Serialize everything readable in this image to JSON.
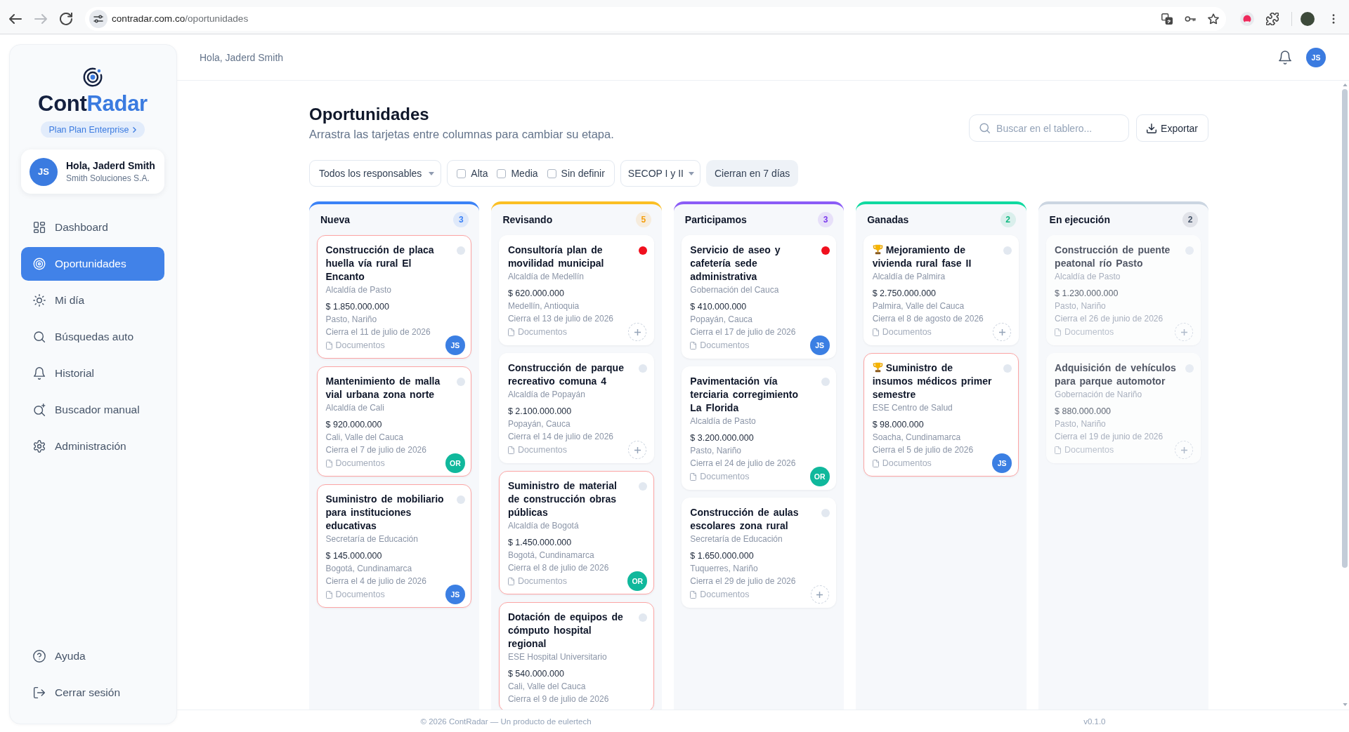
{
  "browser": {
    "nav_buttons": [
      {
        "kind": "back",
        "disabled": false
      },
      {
        "kind": "forward",
        "disabled": true
      },
      {
        "kind": "reload",
        "disabled": false
      }
    ],
    "address_bar": {
      "host": "contradar.com.co",
      "path": "/oportunidades"
    }
  },
  "sidebar": {
    "logo": {
      "name_start": "Cont",
      "name_end": "Radar"
    },
    "plan_badge": "Plan Plan Enterprise",
    "user": {
      "initials": "JS",
      "name": "Hola, Jaderd Smith",
      "company": "Smith Soluciones S.A."
    },
    "nav_items": [
      {
        "kind": "dashboard",
        "label": "Dashboard",
        "selected": false
      },
      {
        "kind": "opportunities",
        "label": "Oportunidades",
        "selected": true
      },
      {
        "kind": "my_day",
        "label": "Mi día",
        "selected": false
      },
      {
        "kind": "auto_search",
        "label": "Búsquedas auto",
        "selected": false
      },
      {
        "kind": "history",
        "label": "Historial",
        "selected": false
      },
      {
        "kind": "manual_search",
        "label": "Buscador manual",
        "selected": false
      },
      {
        "kind": "admin",
        "label": "Administración",
        "selected": false
      }
    ],
    "bottom_items": [
      {
        "kind": "help",
        "label": "Ayuda"
      },
      {
        "kind": "logout",
        "label": "Cerrar sesión"
      }
    ]
  },
  "header": {
    "greeting": "Hola, Jaderd Smith",
    "avatar_initials": "JS"
  },
  "page": {
    "title": "Oportunidades",
    "subtitle": "Arrastra las tarjetas entre columnas para cambiar su etapa.",
    "search": {
      "placeholder": "Buscar en el tablero..."
    },
    "export_button": "Exportar"
  },
  "filters": {
    "responsible_dropdown": "Todos los responsables",
    "priorities": [
      {
        "label": "Alta",
        "checked": false
      },
      {
        "label": "Media",
        "checked": false
      },
      {
        "label": "Sin definir",
        "checked": false
      }
    ],
    "source_dropdown": "SECOP I y II",
    "closing_chip": "Cierran en 7 días"
  },
  "columns": [
    {
      "title": "Nueva",
      "color": "#3b82f6",
      "count": {
        "text": "3",
        "color": "#3b82f6"
      },
      "dimmed": false,
      "cards": [
        {
          "title": "Construcción de placa huella vía rural El Encanto",
          "trophy": false,
          "urgent": true,
          "color": "#e2e8f0",
          "agency": "Alcaldía de Pasto",
          "amount": "$ 1.850.000.000",
          "location": "Pasto, Nariño",
          "closes": "Cierra el 11 de julio de 2026",
          "documents": "Documentos",
          "assignee": {
            "initials": "JS",
            "color": "#3b7fe3"
          }
        },
        {
          "title": "Mantenimiento de malla vial urbana zona norte",
          "trophy": false,
          "urgent": true,
          "color": "#e2e8f0",
          "agency": "Alcaldía de Cali",
          "amount": "$ 920.000.000",
          "location": "Cali, Valle del Cauca",
          "closes": "Cierra el 7 de julio de 2026",
          "documents": "Documentos",
          "assignee": {
            "initials": "OR",
            "color": "#10b89c"
          }
        },
        {
          "title": "Suministro de mobiliario para instituciones educativas",
          "trophy": false,
          "urgent": true,
          "color": "#e2e8f0",
          "agency": "Secretaría de Educación",
          "amount": "$ 145.000.000",
          "location": "Bogotá, Cundinamarca",
          "closes": "Cierra el 4 de julio de 2026",
          "documents": "Documentos",
          "assignee": {
            "initials": "JS",
            "color": "#3b7fe3"
          }
        }
      ]
    },
    {
      "title": "Revisando",
      "color": "#fbbf24",
      "count": {
        "text": "5",
        "color": "#f59e0b"
      },
      "dimmed": false,
      "cards": [
        {
          "title": "Consultoría plan de movilidad municipal",
          "trophy": false,
          "urgent": false,
          "color": "#f0101e",
          "agency": "Alcaldía de Medellín",
          "amount": "$ 620.000.000",
          "location": "Medellín, Antioquia",
          "closes": "Cierra el 13 de julio de 2026",
          "documents": "Documentos"
        },
        {
          "title": "Construcción de parque recreativo comuna 4",
          "trophy": false,
          "urgent": false,
          "color": "#e2e8f0",
          "agency": "Alcaldía de Popayán",
          "amount": "$ 2.100.000.000",
          "location": "Popayán, Cauca",
          "closes": "Cierra el 14 de julio de 2026",
          "documents": "Documentos"
        },
        {
          "title": "Suministro de material de construcción obras públicas",
          "trophy": false,
          "urgent": true,
          "color": "#e2e8f0",
          "agency": "Alcaldía de Bogotá",
          "amount": "$ 1.450.000.000",
          "location": "Bogotá, Cundinamarca",
          "closes": "Cierra el 8 de julio de 2026",
          "documents": "Documentos",
          "assignee": {
            "initials": "OR",
            "color": "#10b89c"
          }
        },
        {
          "title": "Dotación de equipos de cómputo hospital regional",
          "trophy": false,
          "urgent": true,
          "color": "#e2e8f0",
          "agency": "ESE Hospital Universitario",
          "amount": "$ 540.000.000",
          "location": "Cali, Valle del Cauca",
          "closes": "Cierra el 9 de julio de 2026"
        }
      ]
    },
    {
      "title": "Participamos",
      "color": "#8b5cf6",
      "count": {
        "text": "3",
        "color": "#7c3aed"
      },
      "dimmed": false,
      "cards": [
        {
          "title": "Servicio de aseo y cafetería sede administrativa",
          "trophy": false,
          "urgent": false,
          "color": "#f0101e",
          "agency": "Gobernación del Cauca",
          "amount": "$ 410.000.000",
          "location": "Popayán, Cauca",
          "closes": "Cierra el 17 de julio de 2026",
          "documents": "Documentos",
          "assignee": {
            "initials": "JS",
            "color": "#3b7fe3"
          }
        },
        {
          "title": "Pavimentación vía terciaria corregimiento La Florida",
          "trophy": false,
          "urgent": false,
          "color": "#e2e8f0",
          "agency": "Alcaldía de Pasto",
          "amount": "$ 3.200.000.000",
          "location": "Pasto, Nariño",
          "closes": "Cierra el 24 de julio de 2026",
          "documents": "Documentos",
          "assignee": {
            "initials": "OR",
            "color": "#10b89c"
          }
        },
        {
          "title": "Construcción de aulas escolares zona rural",
          "trophy": false,
          "urgent": false,
          "color": "#e2e8f0",
          "agency": "Secretaría de Educación",
          "amount": "$ 1.650.000.000",
          "location": "Tuquerres, Nariño",
          "closes": "Cierra el 29 de julio de 2026",
          "documents": "Documentos"
        }
      ]
    },
    {
      "title": "Ganadas",
      "color": "#10d9a0",
      "count": {
        "text": "2",
        "color": "#10b981"
      },
      "dimmed": false,
      "cards": [
        {
          "title": "Mejoramiento de vivienda rural fase II",
          "trophy": true,
          "urgent": false,
          "color": "#e2e8f0",
          "agency": "Alcaldía de Palmira",
          "amount": "$ 2.750.000.000",
          "location": "Palmira, Valle del Cauca",
          "closes": "Cierra el 8 de agosto de 2026",
          "documents": "Documentos"
        },
        {
          "title": "Suministro de insumos médicos primer semestre",
          "trophy": true,
          "urgent": true,
          "color": "#e2e8f0",
          "agency": "ESE Centro de Salud",
          "amount": "$ 98.000.000",
          "location": "Soacha, Cundinamarca",
          "closes": "Cierra el 5 de julio de 2026",
          "documents": "Documentos",
          "assignee": {
            "initials": "JS",
            "color": "#3b7fe3"
          }
        }
      ]
    },
    {
      "title": "En ejecución",
      "color": "#cbd5e1",
      "count": {
        "text": "2",
        "color": "#475569"
      },
      "dimmed": true,
      "cards": [
        {
          "title": "Construcción de puente peatonal río Pasto",
          "trophy": false,
          "urgent": false,
          "color": "#e2e8f0",
          "agency": "Alcaldía de Pasto",
          "amount": "$ 1.230.000.000",
          "location": "Pasto, Nariño",
          "closes": "Cierra el 26 de junio de 2026",
          "documents": "Documentos"
        },
        {
          "title": "Adquisición de vehículos para parque automotor",
          "trophy": false,
          "urgent": false,
          "color": "#e2e8f0",
          "agency": "Gobernación de Nariño",
          "amount": "$ 880.000.000",
          "location": "Pasto, Nariño",
          "closes": "Cierra el 19 de junio de 2026",
          "documents": "Documentos"
        }
      ]
    }
  ],
  "footer": {
    "copyright": "© 2026 ContRadar — Un producto de eulertech",
    "version": "v0.1.0"
  }
}
